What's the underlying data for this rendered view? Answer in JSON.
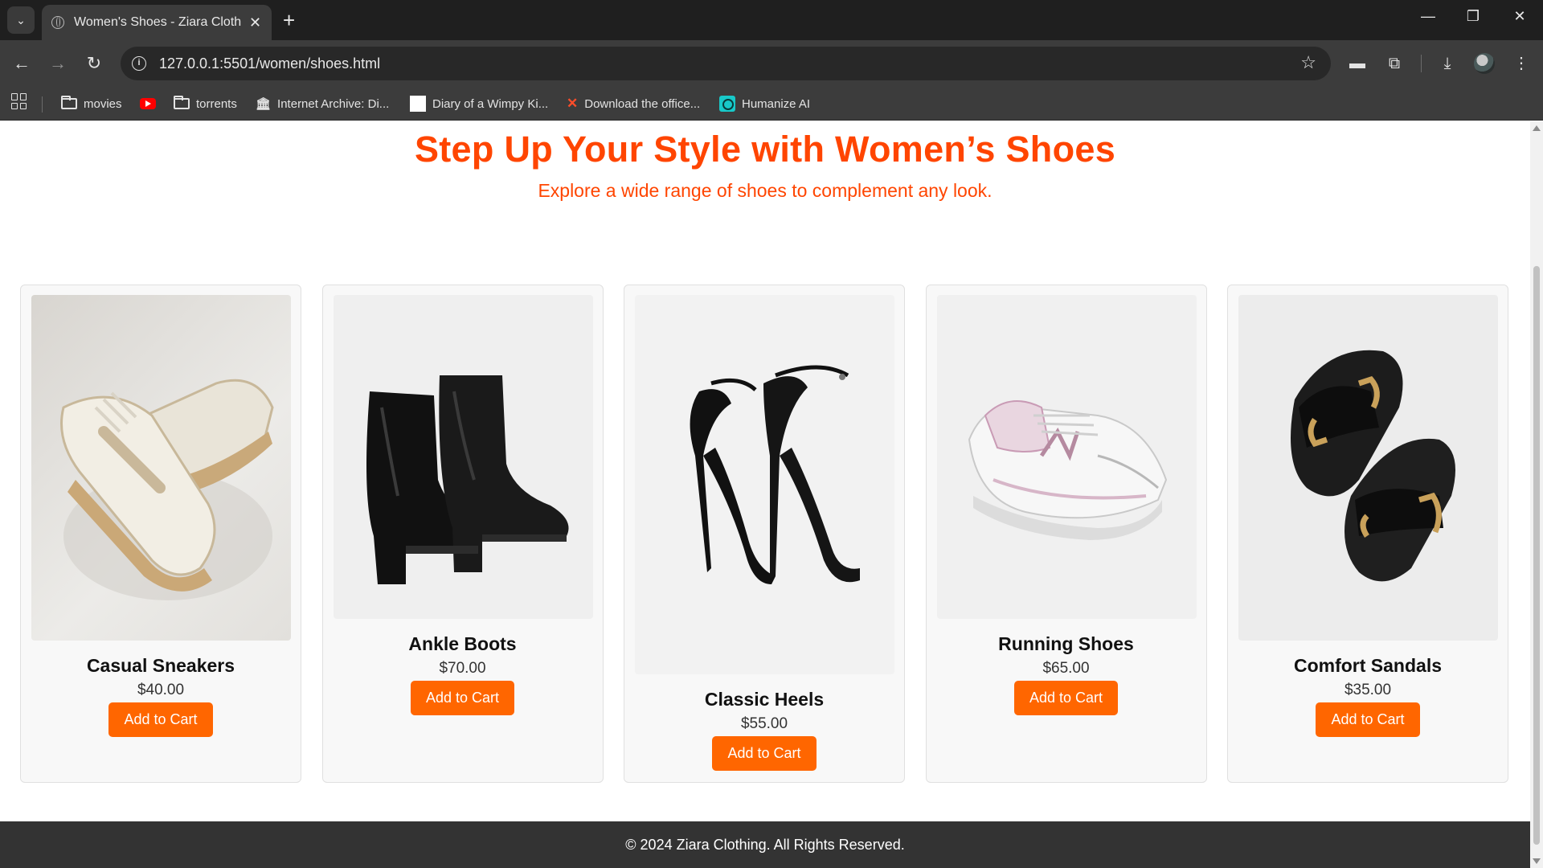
{
  "browser": {
    "tab_title": "Women's Shoes - Ziara Clothing",
    "url": "127.0.0.1:5501/women/shoes.html",
    "bookmarks": [
      {
        "label": "movies",
        "icon": "folder-icon"
      },
      {
        "label": "",
        "icon": "youtube-icon"
      },
      {
        "label": "torrents",
        "icon": "folder-icon"
      },
      {
        "label": "Internet Archive: Di...",
        "icon": "internet-archive-icon"
      },
      {
        "label": "Diary of a Wimpy Ki...",
        "icon": "blank-page-icon"
      },
      {
        "label": "Download the office...",
        "icon": "x-icon"
      },
      {
        "label": "Humanize AI",
        "icon": "humanize-ai-icon"
      }
    ]
  },
  "hero": {
    "title": "Step Up Your Style with Women’s Shoes",
    "subtitle": "Explore a wide range of shoes to complement any look."
  },
  "products": [
    {
      "name": "Casual Sneakers",
      "price": "$40.00",
      "button": "Add to Cart",
      "image": "casual-sneakers-image"
    },
    {
      "name": "Ankle Boots",
      "price": "$70.00",
      "button": "Add to Cart",
      "image": "ankle-boots-image"
    },
    {
      "name": "Classic Heels",
      "price": "$55.00",
      "button": "Add to Cart",
      "image": "classic-heels-image"
    },
    {
      "name": "Running Shoes",
      "price": "$65.00",
      "button": "Add to Cart",
      "image": "running-shoes-image"
    },
    {
      "name": "Comfort Sandals",
      "price": "$35.00",
      "button": "Add to Cart",
      "image": "comfort-sandals-image"
    }
  ],
  "footer": {
    "text": "© 2024 Ziara Clothing. All Rights Reserved."
  },
  "colors": {
    "accent": "#ff4500",
    "button": "#ff6600",
    "footer_bg": "#333333"
  }
}
